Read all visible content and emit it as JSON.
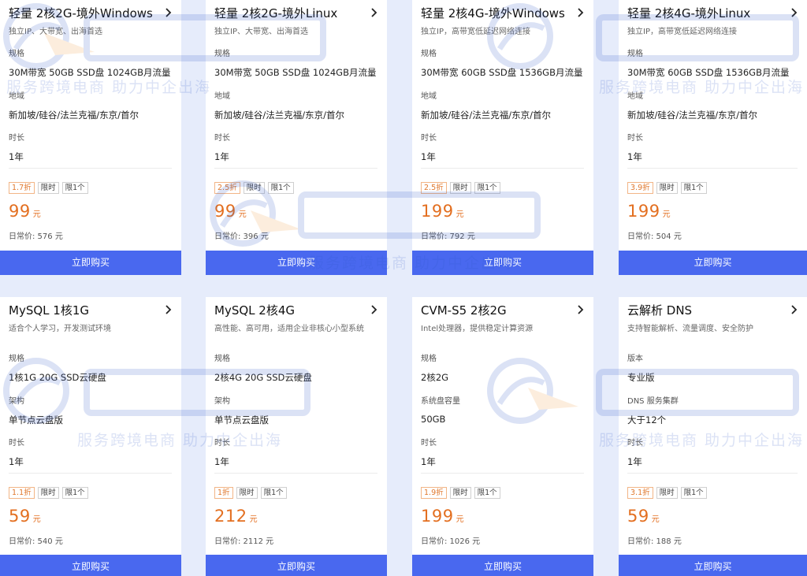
{
  "watermark": {
    "slogan": "服务跨境电商 助力中企出海"
  },
  "cards": [
    {
      "title": "轻量 2核2G-境外Windows",
      "subtitle": "独立IP、大带宽、出海首选",
      "specs": [
        {
          "label": "规格",
          "value": "30M带宽 50GB SSD盘 1024GB月流量"
        },
        {
          "label": "地域",
          "value": "新加坡/硅谷/法兰克福/东京/首尔"
        },
        {
          "label": "时长",
          "value": "1年"
        }
      ],
      "tags": [
        "1.7折",
        "限时",
        "限1个"
      ],
      "price": "99",
      "unit": "元",
      "original_price": "日常价: 576 元",
      "buy_label": "立即购买"
    },
    {
      "title": "轻量 2核2G-境外Linux",
      "subtitle": "独立IP、大带宽、出海首选",
      "specs": [
        {
          "label": "规格",
          "value": "30M带宽 50GB SSD盘 1024GB月流量"
        },
        {
          "label": "地域",
          "value": "新加坡/硅谷/法兰克福/东京/首尔"
        },
        {
          "label": "时长",
          "value": "1年"
        }
      ],
      "tags": [
        "2.5折",
        "限时",
        "限1个"
      ],
      "price": "99",
      "unit": "元",
      "original_price": "日常价: 396 元",
      "buy_label": "立即购买"
    },
    {
      "title": "轻量 2核4G-境外Windows",
      "subtitle": "独立IP，高带宽低延迟网络连接",
      "specs": [
        {
          "label": "规格",
          "value": "30M带宽 60GB SSD盘 1536GB月流量"
        },
        {
          "label": "地域",
          "value": "新加坡/硅谷/法兰克福/东京/首尔"
        },
        {
          "label": "时长",
          "value": "1年"
        }
      ],
      "tags": [
        "2.5折",
        "限时",
        "限1个"
      ],
      "price": "199",
      "unit": "元",
      "original_price": "日常价: 792 元",
      "buy_label": "立即购买"
    },
    {
      "title": "轻量 2核4G-境外Linux",
      "subtitle": "独立IP，高带宽低延迟网络连接",
      "specs": [
        {
          "label": "规格",
          "value": "30M带宽 60GB SSD盘 1536GB月流量"
        },
        {
          "label": "地域",
          "value": "新加坡/硅谷/法兰克福/东京/首尔"
        },
        {
          "label": "时长",
          "value": "1年"
        }
      ],
      "tags": [
        "3.9折",
        "限时",
        "限1个"
      ],
      "price": "199",
      "unit": "元",
      "original_price": "日常价: 504 元",
      "buy_label": "立即购买"
    },
    {
      "title": "MySQL 1核1G",
      "subtitle": "适合个人学习，开发测试环境",
      "specs": [
        {
          "label": "规格",
          "value": "1核1G 20G SSD云硬盘"
        },
        {
          "label": "架构",
          "value": "单节点云盘版"
        },
        {
          "label": "时长",
          "value": "1年"
        }
      ],
      "tags": [
        "1.1折",
        "限时",
        "限1个"
      ],
      "price": "59",
      "unit": "元",
      "original_price": "日常价: 540 元",
      "buy_label": "立即购买"
    },
    {
      "title": "MySQL 2核4G",
      "subtitle": "高性能、高可用，适用企业非核心小型系统",
      "specs": [
        {
          "label": "规格",
          "value": "2核4G 20G SSD云硬盘"
        },
        {
          "label": "架构",
          "value": "单节点云盘版"
        },
        {
          "label": "时长",
          "value": "1年"
        }
      ],
      "tags": [
        "1折",
        "限时",
        "限1个"
      ],
      "price": "212",
      "unit": "元",
      "original_price": "日常价: 2112 元",
      "buy_label": "立即购买"
    },
    {
      "title": "CVM-S5 2核2G",
      "subtitle": "Intel处理器，提供稳定计算资源",
      "specs": [
        {
          "label": "规格",
          "value": "2核2G"
        },
        {
          "label": "系统盘容量",
          "value": "50GB"
        },
        {
          "label": "时长",
          "value": "1年"
        }
      ],
      "tags": [
        "1.9折",
        "限时",
        "限1个"
      ],
      "price": "199",
      "unit": "元",
      "original_price": "日常价: 1026 元",
      "buy_label": "立即购买"
    },
    {
      "title": "云解析 DNS",
      "subtitle": "支持智能解析、流量调度、安全防护",
      "specs": [
        {
          "label": "版本",
          "value": "专业版"
        },
        {
          "label": "DNS 服务集群",
          "value": "大于12个"
        },
        {
          "label": "时长",
          "value": "1年"
        }
      ],
      "tags": [
        "3.1折",
        "限时",
        "限1个"
      ],
      "price": "59",
      "unit": "元",
      "original_price": "日常价: 188 元",
      "buy_label": "立即购买"
    }
  ]
}
